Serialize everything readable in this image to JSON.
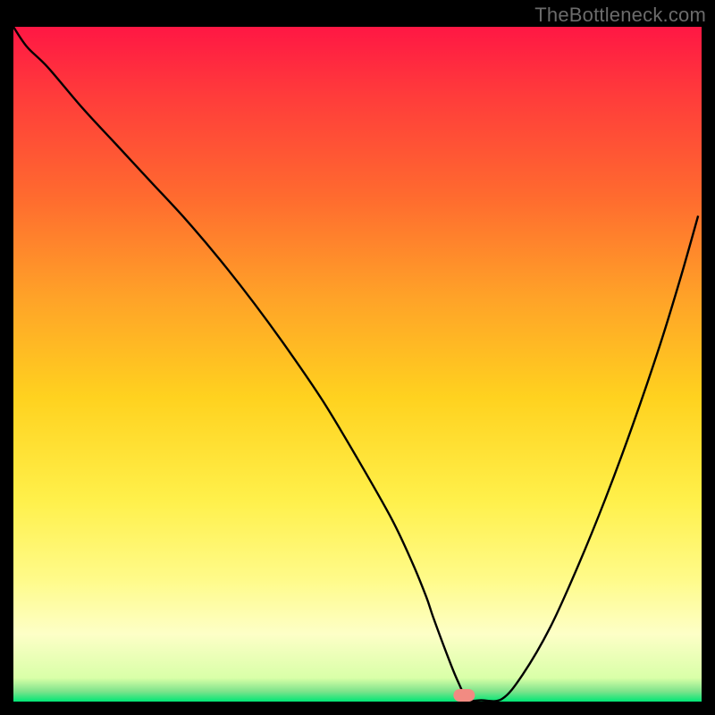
{
  "watermark": "TheBottleneck.com",
  "chart_data": {
    "type": "line",
    "title": "",
    "xlabel": "",
    "ylabel": "",
    "xlim": [
      0,
      100
    ],
    "ylim": [
      0,
      100
    ],
    "grid": false,
    "legend": false,
    "series": [
      {
        "name": "curve",
        "x": [
          0,
          2,
          5,
          10,
          15,
          20,
          25,
          30,
          35,
          40,
          45,
          50,
          55,
          58,
          60,
          61,
          63,
          64.5,
          66,
          68,
          71,
          74,
          78,
          82,
          86,
          90,
          94,
          97,
          99.5
        ],
        "y": [
          100,
          97,
          94,
          88,
          82.5,
          77,
          71.5,
          65.5,
          59,
          52,
          44.5,
          36,
          27,
          20.5,
          15.5,
          12.5,
          7,
          3.2,
          0.4,
          0.2,
          0.4,
          4,
          11,
          20,
          30,
          41,
          53,
          63,
          72
        ],
        "color": "#000000"
      }
    ],
    "marker": {
      "x_fraction": 0.655,
      "color": "#f28b82"
    },
    "gradient_stops": [
      {
        "offset": 0.0,
        "color": "#ff1744"
      },
      {
        "offset": 0.1,
        "color": "#ff3b3b"
      },
      {
        "offset": 0.25,
        "color": "#ff6a2f"
      },
      {
        "offset": 0.4,
        "color": "#ffa228"
      },
      {
        "offset": 0.55,
        "color": "#ffd21f"
      },
      {
        "offset": 0.7,
        "color": "#fff04a"
      },
      {
        "offset": 0.82,
        "color": "#fffb8a"
      },
      {
        "offset": 0.9,
        "color": "#fdffc7"
      },
      {
        "offset": 0.965,
        "color": "#d9ffa8"
      },
      {
        "offset": 0.985,
        "color": "#7de38b"
      },
      {
        "offset": 1.0,
        "color": "#00e676"
      }
    ]
  }
}
